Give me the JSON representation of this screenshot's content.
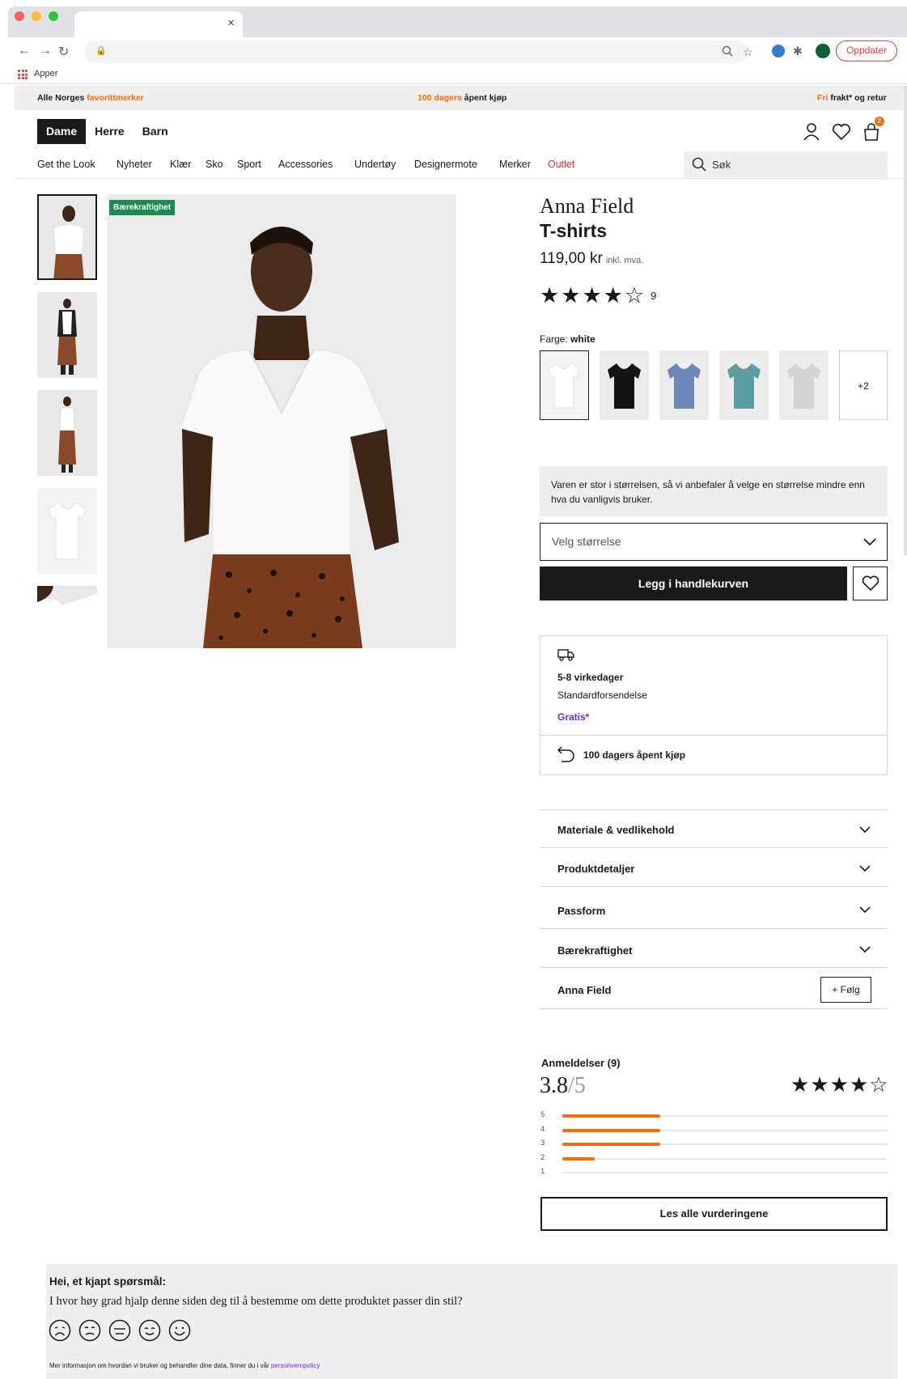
{
  "browser": {
    "tab_close": "×",
    "bookmark_apps": "Apper",
    "update_button": "Oppdater"
  },
  "colors": {
    "accent_orange": "#ff6900",
    "badge_green": "#1c8b50",
    "link_purple": "#6a2bd9",
    "primary_dark": "#1a1a1a"
  },
  "promo": {
    "left_prefix": "Alle Norges ",
    "left_highlight": "favorittmerker",
    "center_highlight": "100 dagers",
    "center_suffix": " åpent kjøp",
    "right_highlight": "Fri",
    "right_suffix": " frakt* og retur"
  },
  "header": {
    "genders": [
      "Dame",
      "Herre",
      "Barn"
    ],
    "active_gender": "Dame",
    "cart_count": "2",
    "icons": [
      "user-icon",
      "heart-icon",
      "bag-icon"
    ]
  },
  "nav": {
    "items": [
      "Get the Look",
      "Nyheter",
      "Klær",
      "Sko",
      "Sport",
      "Accessories",
      "Undertøy",
      "Designermote",
      "Merker"
    ],
    "outlet": "Outlet",
    "search_placeholder": "Søk"
  },
  "gallery": {
    "badge": "Bærekraftighet",
    "thumbnail_count": 5,
    "selected_thumbnail": 1
  },
  "product": {
    "brand": "Anna Field",
    "title": "T-shirts",
    "price": "119,00 kr",
    "price_note": "inkl. mva.",
    "rating_stars_filled": 4,
    "rating_count": "9",
    "color_label": "Farge:",
    "color_value": "white",
    "swatches": [
      "white",
      "black",
      "blue",
      "teal",
      "grey"
    ],
    "swatch_more": "+2",
    "size_note": "Varen er stor i størrelsen, så vi anbefaler å velge en størrelse mindre enn hva du vanligvis bruker.",
    "size_placeholder": "Velg størrelse",
    "add_to_cart": "Legg i handlekurven"
  },
  "delivery": {
    "days": "5-8 virkedager",
    "type": "Standardforsendelse",
    "price": "Gratis*",
    "return": "100 dagers åpent kjøp"
  },
  "accordion": {
    "items": [
      "Materiale & vedlikehold",
      "Produktdetaljer",
      "Passform",
      "Bærekraftighet"
    ],
    "brand_row": "Anna Field",
    "follow": "Følg"
  },
  "reviews": {
    "heading": "Anmeldelser (9)",
    "score": "3.8",
    "score_max": "/5",
    "stars_filled": 4,
    "breakdown": [
      {
        "stars": "5",
        "fraction": 0.3
      },
      {
        "stars": "4",
        "fraction": 0.3
      },
      {
        "stars": "3",
        "fraction": 0.3
      },
      {
        "stars": "2",
        "fraction": 0.1
      },
      {
        "stars": "1",
        "fraction": 0.0
      }
    ],
    "read_all": "Les alle vurderingene"
  },
  "survey": {
    "question_title": "Hei, et kjapt spørsmål:",
    "question": "I hvor høy grad hjalp denne siden deg til å bestemme om dette produktet passer din stil?",
    "footer_prefix": "Mer informasjon om hvordan vi bruker og behandler dine data, finner du i vår ",
    "footer_link": "personvernpolicy"
  }
}
